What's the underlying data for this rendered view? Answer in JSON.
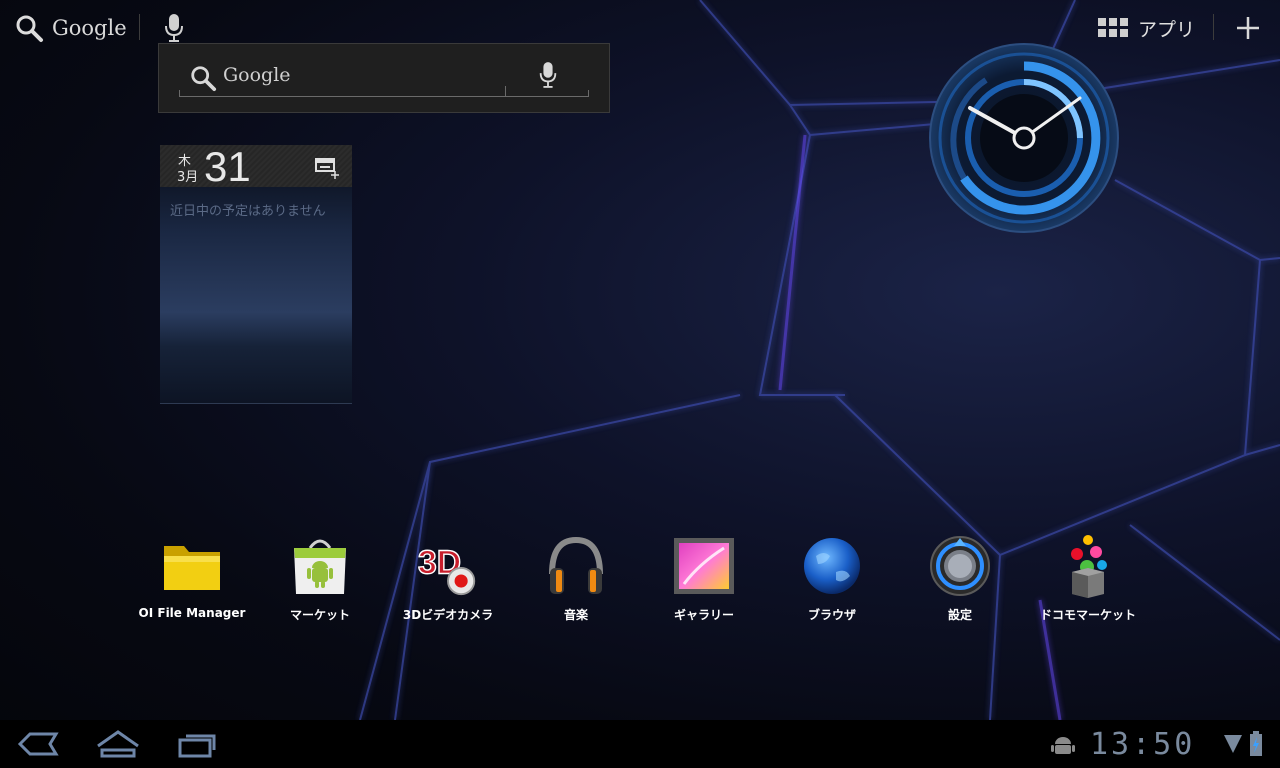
{
  "top_bar": {
    "search_label": "Google",
    "apps_label": "アプリ"
  },
  "search_widget": {
    "label": "Google"
  },
  "calendar_widget": {
    "day_of_week": "木",
    "month": "3月",
    "day": "31",
    "empty_message": "近日中の予定はありません"
  },
  "dock": {
    "items": [
      {
        "label": "OI File Manager",
        "icon": "folder-icon"
      },
      {
        "label": "マーケット",
        "icon": "market-bag-icon"
      },
      {
        "label": "3Dビデオカメラ",
        "icon": "3d-video-camera-icon"
      },
      {
        "label": "音楽",
        "icon": "headphones-icon"
      },
      {
        "label": "ギャラリー",
        "icon": "gallery-icon"
      },
      {
        "label": "ブラウザ",
        "icon": "globe-icon"
      },
      {
        "label": "設定",
        "icon": "settings-icon"
      },
      {
        "label": "ドコモマーケット",
        "icon": "docomo-market-icon"
      }
    ]
  },
  "system_bar": {
    "time": "13:50"
  },
  "colors": {
    "clock_accent": "#3aa0ff",
    "wallpaper_glow": "#5a6aff",
    "folder_yellow": "#e8c000"
  }
}
